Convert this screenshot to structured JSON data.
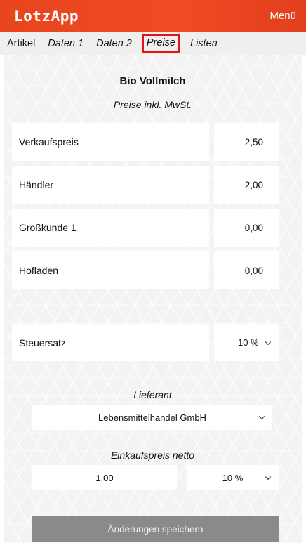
{
  "header": {
    "logo": "LotzApp",
    "menu_label": "Menü"
  },
  "tabs": [
    {
      "label": "Artikel"
    },
    {
      "label": "Daten 1"
    },
    {
      "label": "Daten 2"
    },
    {
      "label": "Preise"
    },
    {
      "label": "Listen"
    }
  ],
  "active_tab": "Preise",
  "product": {
    "name": "Bio Vollmilch",
    "subtitle": "Preise inkl. MwSt."
  },
  "prices": [
    {
      "label": "Verkaufspreis",
      "value": "2,50"
    },
    {
      "label": "Händler",
      "value": "2,00"
    },
    {
      "label": "Großkunde 1",
      "value": "0,00"
    },
    {
      "label": "Hofladen",
      "value": "0,00"
    }
  ],
  "tax": {
    "label": "Steuersatz",
    "value": "10 %"
  },
  "supplier": {
    "label": "Lieferant",
    "value": "Lebensmittelhandel GmbH"
  },
  "purchase": {
    "label": "Einkaufspreis netto",
    "price": "1,00",
    "tax_value": "10 %"
  },
  "save_label": "Änderungen speichern",
  "colors": {
    "header_accent": "#ef4a24",
    "active_tab_border": "#e2141b",
    "save_button": "#8a8a8a"
  }
}
